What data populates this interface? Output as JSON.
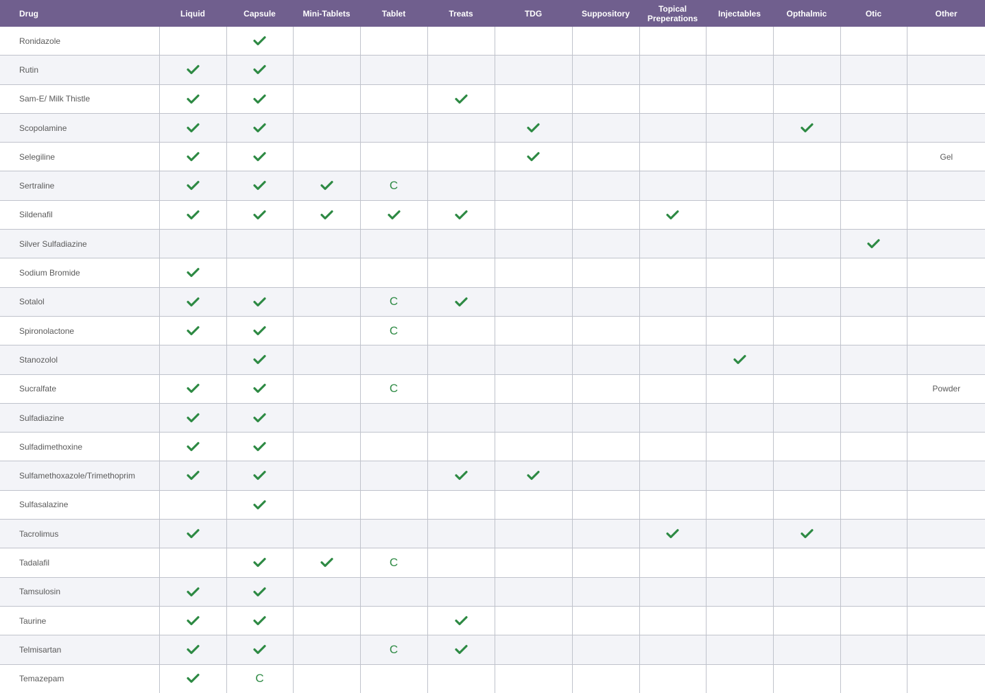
{
  "colors": {
    "header_bg": "#705f8e",
    "check": "#2e8a44",
    "row_stripe": "#f3f4f8",
    "grid": "#bfc2cb"
  },
  "columns": [
    "Drug",
    "Liquid",
    "Capsule",
    "Mini-Tablets",
    "Tablet",
    "Treats",
    "TDG",
    "Suppository",
    "Topical Preperations",
    "Injectables",
    "Opthalmic",
    "Otic",
    "Other"
  ],
  "legend": {
    "check_icon": "check-icon"
  },
  "rows": [
    {
      "drug": "Ronidazole",
      "cells": [
        "",
        "check",
        "",
        "",
        "",
        "",
        "",
        "",
        "",
        "",
        "",
        ""
      ]
    },
    {
      "drug": "Rutin",
      "cells": [
        "check",
        "check",
        "",
        "",
        "",
        "",
        "",
        "",
        "",
        "",
        "",
        ""
      ]
    },
    {
      "drug": "Sam-E/ Milk Thistle",
      "cells": [
        "check",
        "check",
        "",
        "",
        "check",
        "",
        "",
        "",
        "",
        "",
        "",
        ""
      ]
    },
    {
      "drug": "Scopolamine",
      "cells": [
        "check",
        "check",
        "",
        "",
        "",
        "check",
        "",
        "",
        "",
        "check",
        "",
        ""
      ]
    },
    {
      "drug": "Selegiline",
      "cells": [
        "check",
        "check",
        "",
        "",
        "",
        "check",
        "",
        "",
        "",
        "",
        "",
        "Gel"
      ]
    },
    {
      "drug": "Sertraline",
      "cells": [
        "check",
        "check",
        "check",
        "C",
        "",
        "",
        "",
        "",
        "",
        "",
        "",
        ""
      ]
    },
    {
      "drug": "Sildenafil",
      "cells": [
        "check",
        "check",
        "check",
        "check",
        "check",
        "",
        "",
        "check",
        "",
        "",
        "",
        ""
      ]
    },
    {
      "drug": "Silver Sulfadiazine",
      "cells": [
        "",
        "",
        "",
        "",
        "",
        "",
        "",
        "",
        "",
        "",
        "check",
        ""
      ]
    },
    {
      "drug": "Sodium Bromide",
      "cells": [
        "check",
        "",
        "",
        "",
        "",
        "",
        "",
        "",
        "",
        "",
        "",
        ""
      ]
    },
    {
      "drug": "Sotalol",
      "cells": [
        "check",
        "check",
        "",
        "C",
        "check",
        "",
        "",
        "",
        "",
        "",
        "",
        ""
      ]
    },
    {
      "drug": "Spironolactone",
      "cells": [
        "check",
        "check",
        "",
        "C",
        "",
        "",
        "",
        "",
        "",
        "",
        "",
        ""
      ]
    },
    {
      "drug": "Stanozolol",
      "cells": [
        "",
        "check",
        "",
        "",
        "",
        "",
        "",
        "",
        "check",
        "",
        "",
        ""
      ]
    },
    {
      "drug": "Sucralfate",
      "cells": [
        "check",
        "check",
        "",
        "C",
        "",
        "",
        "",
        "",
        "",
        "",
        "",
        "Powder"
      ]
    },
    {
      "drug": "Sulfadiazine",
      "cells": [
        "check",
        "check",
        "",
        "",
        "",
        "",
        "",
        "",
        "",
        "",
        "",
        ""
      ]
    },
    {
      "drug": "Sulfadimethoxine",
      "cells": [
        "check",
        "check",
        "",
        "",
        "",
        "",
        "",
        "",
        "",
        "",
        "",
        ""
      ]
    },
    {
      "drug": "Sulfamethoxazole/Trimethoprim",
      "cells": [
        "check",
        "check",
        "",
        "",
        "check",
        "check",
        "",
        "",
        "",
        "",
        "",
        ""
      ]
    },
    {
      "drug": "Sulfasalazine",
      "cells": [
        "",
        "check",
        "",
        "",
        "",
        "",
        "",
        "",
        "",
        "",
        "",
        ""
      ]
    },
    {
      "drug": "Tacrolimus",
      "cells": [
        "check",
        "",
        "",
        "",
        "",
        "",
        "",
        "check",
        "",
        "check",
        "",
        ""
      ]
    },
    {
      "drug": "Tadalafil",
      "cells": [
        "",
        "check",
        "check",
        "C",
        "",
        "",
        "",
        "",
        "",
        "",
        "",
        ""
      ]
    },
    {
      "drug": "Tamsulosin",
      "cells": [
        "check",
        "check",
        "",
        "",
        "",
        "",
        "",
        "",
        "",
        "",
        "",
        ""
      ]
    },
    {
      "drug": "Taurine",
      "cells": [
        "check",
        "check",
        "",
        "",
        "check",
        "",
        "",
        "",
        "",
        "",
        "",
        ""
      ]
    },
    {
      "drug": "Telmisartan",
      "cells": [
        "check",
        "check",
        "",
        "C",
        "check",
        "",
        "",
        "",
        "",
        "",
        "",
        ""
      ]
    },
    {
      "drug": "Temazepam",
      "cells": [
        "check",
        "C",
        "",
        "",
        "",
        "",
        "",
        "",
        "",
        "",
        "",
        ""
      ]
    }
  ]
}
